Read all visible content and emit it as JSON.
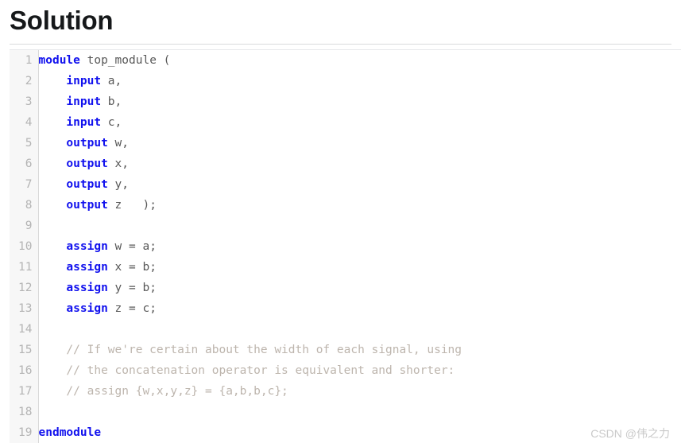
{
  "page": {
    "title": "Solution",
    "background_color": "#ffffff"
  },
  "colors": {
    "heading": "#16181a",
    "rule": "#d9dbdd",
    "gutter_bg": "#f7f7f7",
    "gutter_border": "#d8d8d8",
    "lineno": "#b4b4b4",
    "code_text": "#585858",
    "keyword": "#1111ee",
    "comment": "#bdb5ad",
    "watermark": "#c9c9c9"
  },
  "code_block": {
    "language": "verilog",
    "line_numbers": [
      "1",
      "2",
      "3",
      "4",
      "5",
      "6",
      "7",
      "8",
      "9",
      "10",
      "11",
      "12",
      "13",
      "14",
      "15",
      "16",
      "17",
      "18",
      "19"
    ],
    "lines": [
      {
        "number": "1",
        "tokens": [
          {
            "t": "module",
            "k": "keyword"
          },
          {
            "t": " top_module (",
            "k": "plain"
          }
        ]
      },
      {
        "number": "2",
        "tokens": [
          {
            "t": "    ",
            "k": "plain"
          },
          {
            "t": "input",
            "k": "keyword"
          },
          {
            "t": " a,",
            "k": "plain"
          }
        ]
      },
      {
        "number": "3",
        "tokens": [
          {
            "t": "    ",
            "k": "plain"
          },
          {
            "t": "input",
            "k": "keyword"
          },
          {
            "t": " b,",
            "k": "plain"
          }
        ]
      },
      {
        "number": "4",
        "tokens": [
          {
            "t": "    ",
            "k": "plain"
          },
          {
            "t": "input",
            "k": "keyword"
          },
          {
            "t": " c,",
            "k": "plain"
          }
        ]
      },
      {
        "number": "5",
        "tokens": [
          {
            "t": "    ",
            "k": "plain"
          },
          {
            "t": "output",
            "k": "keyword"
          },
          {
            "t": " w,",
            "k": "plain"
          }
        ]
      },
      {
        "number": "6",
        "tokens": [
          {
            "t": "    ",
            "k": "plain"
          },
          {
            "t": "output",
            "k": "keyword"
          },
          {
            "t": " x,",
            "k": "plain"
          }
        ]
      },
      {
        "number": "7",
        "tokens": [
          {
            "t": "    ",
            "k": "plain"
          },
          {
            "t": "output",
            "k": "keyword"
          },
          {
            "t": " y,",
            "k": "plain"
          }
        ]
      },
      {
        "number": "8",
        "tokens": [
          {
            "t": "    ",
            "k": "plain"
          },
          {
            "t": "output",
            "k": "keyword"
          },
          {
            "t": " z   );",
            "k": "plain"
          }
        ]
      },
      {
        "number": "9",
        "tokens": [
          {
            "t": "",
            "k": "plain"
          }
        ]
      },
      {
        "number": "10",
        "tokens": [
          {
            "t": "    ",
            "k": "plain"
          },
          {
            "t": "assign",
            "k": "keyword"
          },
          {
            "t": " w = a;",
            "k": "plain"
          }
        ]
      },
      {
        "number": "11",
        "tokens": [
          {
            "t": "    ",
            "k": "plain"
          },
          {
            "t": "assign",
            "k": "keyword"
          },
          {
            "t": " x = b;",
            "k": "plain"
          }
        ]
      },
      {
        "number": "12",
        "tokens": [
          {
            "t": "    ",
            "k": "plain"
          },
          {
            "t": "assign",
            "k": "keyword"
          },
          {
            "t": " y = b;",
            "k": "plain"
          }
        ]
      },
      {
        "number": "13",
        "tokens": [
          {
            "t": "    ",
            "k": "plain"
          },
          {
            "t": "assign",
            "k": "keyword"
          },
          {
            "t": " z = c;",
            "k": "plain"
          }
        ]
      },
      {
        "number": "14",
        "tokens": [
          {
            "t": "",
            "k": "plain"
          }
        ]
      },
      {
        "number": "15",
        "tokens": [
          {
            "t": "    ",
            "k": "plain"
          },
          {
            "t": "// If we're certain about the width of each signal, using",
            "k": "comment"
          }
        ]
      },
      {
        "number": "16",
        "tokens": [
          {
            "t": "    ",
            "k": "plain"
          },
          {
            "t": "// the concatenation operator is equivalent and shorter:",
            "k": "comment"
          }
        ]
      },
      {
        "number": "17",
        "tokens": [
          {
            "t": "    ",
            "k": "plain"
          },
          {
            "t": "// assign {w,x,y,z} = {a,b,b,c};",
            "k": "comment"
          }
        ]
      },
      {
        "number": "18",
        "tokens": [
          {
            "t": "",
            "k": "plain"
          }
        ]
      },
      {
        "number": "19",
        "tokens": [
          {
            "t": "endmodule",
            "k": "keyword"
          }
        ]
      }
    ]
  },
  "watermark": {
    "text": "CSDN @伟之力"
  }
}
